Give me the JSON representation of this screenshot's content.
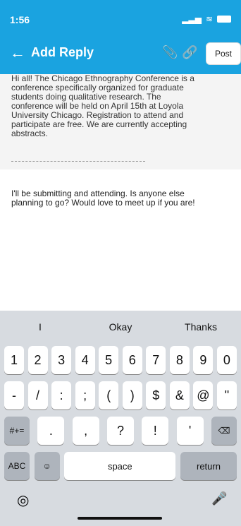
{
  "status": {
    "time": "1:56",
    "network_icon": "location-arrow-icon",
    "signal_icon": "signal-icon",
    "wifi_icon": "wifi-icon",
    "battery_icon": "battery-icon"
  },
  "header": {
    "title": "Add Reply",
    "back_icon": "arrow-left-icon",
    "attach_icon": "paperclip-icon",
    "link_icon": "link-icon",
    "post_label": "Post"
  },
  "quoted_text": "Hi all! The Chicago Ethnography Conference is a\nconference specifically organized for graduate\nstudents doing qualitative research. The\nconference will be held on April 15th at Loyola\nUniversity Chicago. Registration to attend and\nparticipate are free. We are currently accepting\nabstracts.",
  "reply_text": "I'll be submitting and attending. Is anyone else\nplanning to go? Would love to meet up if you are!",
  "keyboard": {
    "suggestions": [
      "I",
      "Okay",
      "Thanks"
    ],
    "row1": [
      "1",
      "2",
      "3",
      "4",
      "5",
      "6",
      "7",
      "8",
      "9",
      "0"
    ],
    "row2": [
      "-",
      "/",
      ":",
      ";",
      "(",
      ")",
      "$",
      "&",
      "@",
      "\""
    ],
    "row3": [
      "#+=",
      ".",
      ",",
      "?",
      "!",
      "'",
      "⌫"
    ],
    "row4": [
      "ABC",
      "☺",
      "space",
      "return"
    ]
  }
}
